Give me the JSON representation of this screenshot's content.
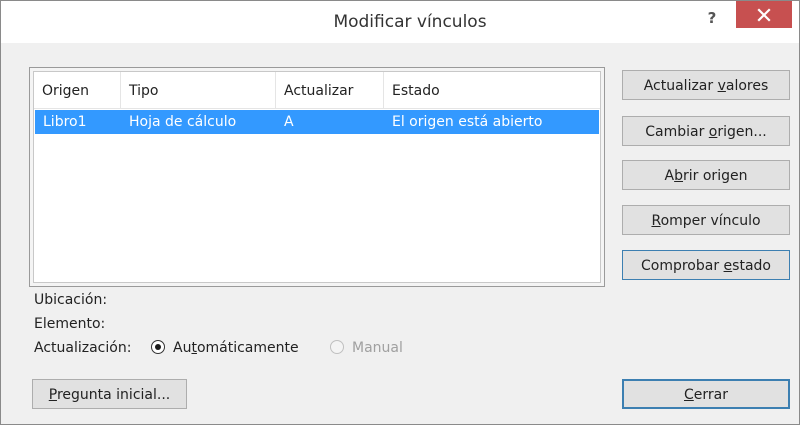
{
  "dialog": {
    "title": "Modificar vínculos",
    "help_label": "?"
  },
  "links_table": {
    "columns": [
      "Origen",
      "Tipo",
      "Actualizar",
      "Estado"
    ],
    "rows": [
      {
        "origen": "Libro1",
        "tipo": "Hoja de cálculo",
        "actualizar": "A",
        "estado": "El origen está abierto",
        "selected": true
      }
    ]
  },
  "buttons": {
    "update_values": {
      "pre": "Actualizar ",
      "key": "v",
      "post": "alores"
    },
    "change_source": {
      "pre": "Cambiar ",
      "key": "o",
      "post": "rigen..."
    },
    "open_source": {
      "pre": "A",
      "key": "b",
      "post": "rir origen"
    },
    "break_link": {
      "pre": "",
      "key": "R",
      "post": "omper vínculo"
    },
    "check_status": {
      "pre": "Comprobar ",
      "key": "e",
      "post": "stado"
    },
    "startup_prompt": {
      "pre": "",
      "key": "P",
      "post": "regunta inicial..."
    },
    "close": {
      "pre": "",
      "key": "C",
      "post": "errar"
    }
  },
  "details": {
    "location_label": "Ubicación:",
    "item_label": "Elemento:",
    "update_label": "Actualización:"
  },
  "update_mode": {
    "automatic": {
      "pre": "Au",
      "key": "t",
      "post": "omáticamente",
      "checked": true
    },
    "manual": {
      "label": "Manual",
      "checked": false,
      "disabled": true
    }
  },
  "colors": {
    "selection": "#3399ff",
    "close_button": "#c75050",
    "default_button_border": "#3c7fb1"
  }
}
